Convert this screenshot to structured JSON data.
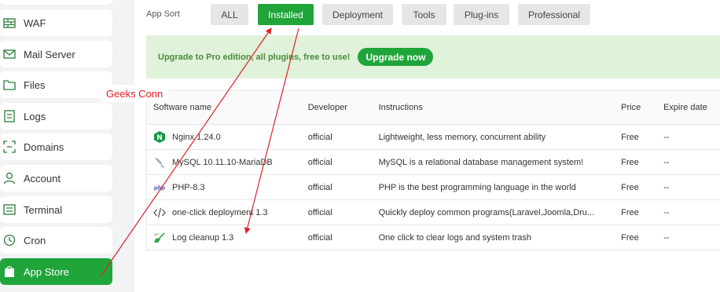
{
  "sidebar": {
    "items": [
      {
        "label": "WAF",
        "icon": "waf-icon"
      },
      {
        "label": "Mail Server",
        "icon": "mail-icon"
      },
      {
        "label": "Files",
        "icon": "folder-icon"
      },
      {
        "label": "Logs",
        "icon": "logs-icon"
      },
      {
        "label": "Domains",
        "icon": "domains-icon"
      },
      {
        "label": "Account",
        "icon": "user-icon"
      },
      {
        "label": "Terminal",
        "icon": "terminal-icon"
      },
      {
        "label": "Cron",
        "icon": "clock-icon"
      },
      {
        "label": "App Store",
        "icon": "store-icon",
        "active": true
      }
    ]
  },
  "main": {
    "sort_label": "App Sort",
    "tabs": [
      "ALL",
      "Installed",
      "Deployment",
      "Tools",
      "Plug-ins",
      "Professional"
    ],
    "active_tab": "Installed",
    "banner": {
      "text": "Upgrade to Pro edition, all plugins, free to use!",
      "button": "Upgrade now"
    },
    "table": {
      "columns": [
        "Software name",
        "Developer",
        "Instructions",
        "Price",
        "Expire date"
      ],
      "rows": [
        {
          "name": "Nginx 1.24.0",
          "icon": "nginx-icon",
          "developer": "official",
          "instructions": "Lightweight, less memory, concurrent ability",
          "price": "Free",
          "expire": "--"
        },
        {
          "name": "MySQL 10.11.10-MariaDB",
          "icon": "mysql-icon",
          "developer": "official",
          "instructions": "MySQL is a relational database management system!",
          "price": "Free",
          "expire": "--"
        },
        {
          "name": "PHP-8.3",
          "icon": "php-icon",
          "developer": "official",
          "instructions": "PHP is the best programming language in the world",
          "price": "Free",
          "expire": "--"
        },
        {
          "name": "one-click deployment 1.3",
          "icon": "code-icon",
          "developer": "official",
          "instructions": "Quickly deploy common programs(Laravel,Joomla,Dru...",
          "price": "Free",
          "expire": "--"
        },
        {
          "name": "Log cleanup 1.3",
          "icon": "broom-icon",
          "developer": "official",
          "instructions": "One click to clear logs and system trash",
          "price": "Free",
          "expire": "--"
        }
      ]
    }
  },
  "annotation": {
    "text": "Geeks Conn",
    "color": "#e0202a"
  },
  "colors": {
    "accent": "#20a53a",
    "banner_bg": "#e0f2d9"
  }
}
